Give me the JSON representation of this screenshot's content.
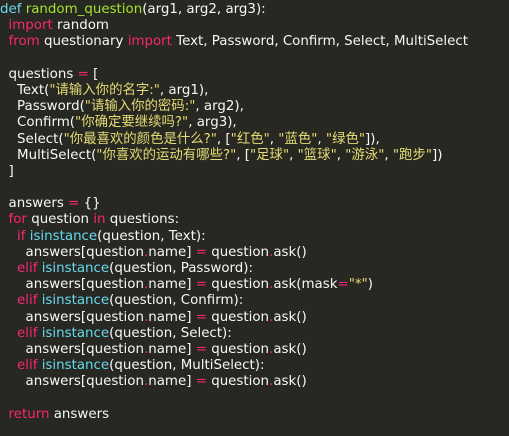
{
  "editor": {
    "colors": {
      "background": "#272822",
      "default": "#f8f8f2",
      "keyword": "#f92672",
      "function": "#a6e22e",
      "string": "#e6db74",
      "storage": "#66d9ef"
    },
    "lines": [
      [
        [
          "def",
          "storage"
        ],
        [
          " ",
          "default"
        ],
        [
          "random_question",
          "function"
        ],
        [
          "(arg1, arg2, arg3):",
          "default"
        ]
      ],
      [
        [
          "  ",
          "default"
        ],
        [
          "import",
          "keyword"
        ],
        [
          " random",
          "default"
        ]
      ],
      [
        [
          "  ",
          "default"
        ],
        [
          "from",
          "keyword"
        ],
        [
          " questionary ",
          "default"
        ],
        [
          "import",
          "keyword"
        ],
        [
          " Text, Password, Confirm, Select, MultiSelect",
          "default"
        ]
      ],
      [],
      [
        [
          "  questions ",
          "default"
        ],
        [
          "=",
          "keyword"
        ],
        [
          " [",
          "default"
        ]
      ],
      [
        [
          "    Text(",
          "default"
        ],
        [
          "\"请输入你的名字:\"",
          "string"
        ],
        [
          ", arg1),",
          "default"
        ]
      ],
      [
        [
          "    Password(",
          "default"
        ],
        [
          "\"请输入你的密码:\"",
          "string"
        ],
        [
          ", arg2),",
          "default"
        ]
      ],
      [
        [
          "    Confirm(",
          "default"
        ],
        [
          "\"你确定要继续吗?\"",
          "string"
        ],
        [
          ", arg3),",
          "default"
        ]
      ],
      [
        [
          "    Select(",
          "default"
        ],
        [
          "\"你最喜欢的颜色是什么?\"",
          "string"
        ],
        [
          ", [",
          "default"
        ],
        [
          "\"红色\"",
          "string"
        ],
        [
          ", ",
          "default"
        ],
        [
          "\"蓝色\"",
          "string"
        ],
        [
          ", ",
          "default"
        ],
        [
          "\"绿色\"",
          "string"
        ],
        [
          "]),",
          "default"
        ]
      ],
      [
        [
          "    MultiSelect(",
          "default"
        ],
        [
          "\"你喜欢的运动有哪些?\"",
          "string"
        ],
        [
          ", [",
          "default"
        ],
        [
          "\"足球\"",
          "string"
        ],
        [
          ", ",
          "default"
        ],
        [
          "\"篮球\"",
          "string"
        ],
        [
          ", ",
          "default"
        ],
        [
          "\"游泳\"",
          "string"
        ],
        [
          ", ",
          "default"
        ],
        [
          "\"跑步\"",
          "string"
        ],
        [
          "])",
          "default"
        ]
      ],
      [
        [
          "  ]",
          "default"
        ]
      ],
      [],
      [
        [
          "  answers ",
          "default"
        ],
        [
          "=",
          "keyword"
        ],
        [
          " {}",
          "default"
        ]
      ],
      [
        [
          "  ",
          "default"
        ],
        [
          "for",
          "keyword"
        ],
        [
          " question ",
          "default"
        ],
        [
          "in",
          "keyword"
        ],
        [
          " questions:",
          "default"
        ]
      ],
      [
        [
          "    ",
          "default"
        ],
        [
          "if",
          "keyword"
        ],
        [
          " ",
          "default"
        ],
        [
          "isinstance",
          "storage"
        ],
        [
          "(question, Text):",
          "default"
        ]
      ],
      [
        [
          "      answers[question",
          "default"
        ],
        [
          ".",
          "keyword"
        ],
        [
          "name] ",
          "default"
        ],
        [
          "=",
          "keyword"
        ],
        [
          " question",
          "default"
        ],
        [
          ".",
          "keyword"
        ],
        [
          "ask()",
          "default"
        ]
      ],
      [
        [
          "    ",
          "default"
        ],
        [
          "elif",
          "keyword"
        ],
        [
          " ",
          "default"
        ],
        [
          "isinstance",
          "storage"
        ],
        [
          "(question, Password):",
          "default"
        ]
      ],
      [
        [
          "      answers[question",
          "default"
        ],
        [
          ".",
          "keyword"
        ],
        [
          "name] ",
          "default"
        ],
        [
          "=",
          "keyword"
        ],
        [
          " question",
          "default"
        ],
        [
          ".",
          "keyword"
        ],
        [
          "ask(mask",
          "default"
        ],
        [
          "=",
          "keyword"
        ],
        [
          "\"*\"",
          "string"
        ],
        [
          ")",
          "default"
        ]
      ],
      [
        [
          "    ",
          "default"
        ],
        [
          "elif",
          "keyword"
        ],
        [
          " ",
          "default"
        ],
        [
          "isinstance",
          "storage"
        ],
        [
          "(question, Confirm):",
          "default"
        ]
      ],
      [
        [
          "      answers[question",
          "default"
        ],
        [
          ".",
          "keyword"
        ],
        [
          "name] ",
          "default"
        ],
        [
          "=",
          "keyword"
        ],
        [
          " question",
          "default"
        ],
        [
          ".",
          "keyword"
        ],
        [
          "ask()",
          "default"
        ]
      ],
      [
        [
          "    ",
          "default"
        ],
        [
          "elif",
          "keyword"
        ],
        [
          " ",
          "default"
        ],
        [
          "isinstance",
          "storage"
        ],
        [
          "(question, Select):",
          "default"
        ]
      ],
      [
        [
          "      answers[question",
          "default"
        ],
        [
          ".",
          "keyword"
        ],
        [
          "name] ",
          "default"
        ],
        [
          "=",
          "keyword"
        ],
        [
          " question",
          "default"
        ],
        [
          ".",
          "keyword"
        ],
        [
          "ask()",
          "default"
        ]
      ],
      [
        [
          "    ",
          "default"
        ],
        [
          "elif",
          "keyword"
        ],
        [
          " ",
          "default"
        ],
        [
          "isinstance",
          "storage"
        ],
        [
          "(question, MultiSelect):",
          "default"
        ]
      ],
      [
        [
          "      answers[question",
          "default"
        ],
        [
          ".",
          "keyword"
        ],
        [
          "name] ",
          "default"
        ],
        [
          "=",
          "keyword"
        ],
        [
          " question",
          "default"
        ],
        [
          ".",
          "keyword"
        ],
        [
          "ask()",
          "default"
        ]
      ],
      [],
      [
        [
          "  ",
          "default"
        ],
        [
          "return",
          "keyword"
        ],
        [
          " answers",
          "default"
        ]
      ]
    ]
  }
}
